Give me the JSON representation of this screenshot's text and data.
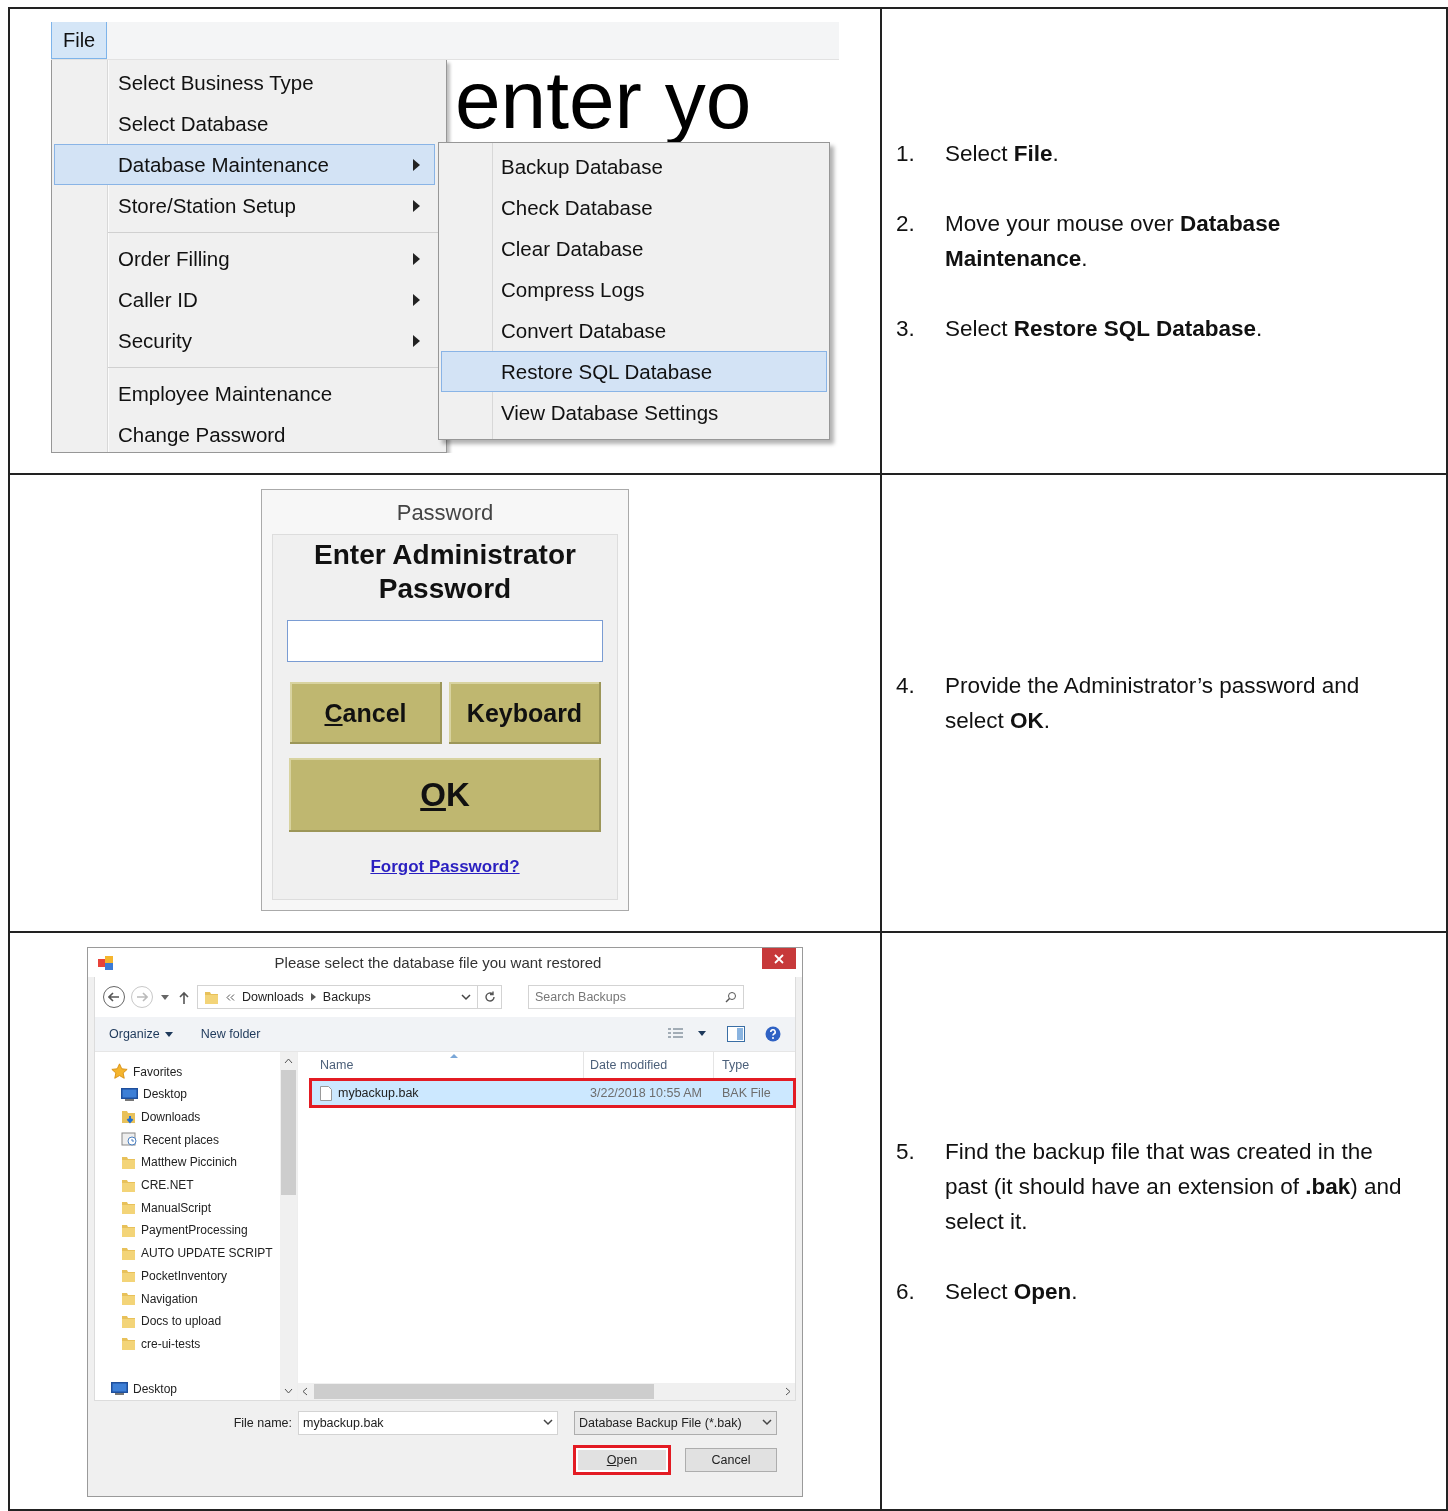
{
  "rows": [
    {
      "kind": "menu",
      "menubar": [
        {
          "label": "File",
          "selected": true
        }
      ],
      "background_text": "enter yo",
      "menu": {
        "groups": [
          [
            {
              "label": "Select Business Type",
              "submenu": false,
              "selected": false
            },
            {
              "label": "Select Database",
              "submenu": false,
              "selected": false
            },
            {
              "label": "Database Maintenance",
              "submenu": true,
              "selected": true
            },
            {
              "label": "Store/Station Setup",
              "submenu": true,
              "selected": false
            }
          ],
          [
            {
              "label": "Order Filling",
              "submenu": true,
              "selected": false
            },
            {
              "label": "Caller ID",
              "submenu": true,
              "selected": false
            },
            {
              "label": "Security",
              "submenu": true,
              "selected": false
            }
          ],
          [
            {
              "label": "Employee Maintenance",
              "submenu": false,
              "selected": false
            },
            {
              "label": "Change Password",
              "submenu": false,
              "selected": false
            }
          ]
        ]
      },
      "submenu": {
        "items": [
          {
            "label": "Backup Database",
            "selected": false
          },
          {
            "label": "Check Database",
            "selected": false
          },
          {
            "label": "Clear Database",
            "selected": false
          },
          {
            "label": "Compress Logs",
            "selected": false
          },
          {
            "label": "Convert Database",
            "selected": false
          },
          {
            "label": "Restore SQL Database",
            "selected": true
          },
          {
            "label": "View Database Settings",
            "selected": false
          }
        ]
      },
      "steps": [
        {
          "number": "1.",
          "text": "Select **File**."
        },
        {
          "number": "2.",
          "text": "Move your mouse over **Database Maintenance**."
        },
        {
          "number": "3.",
          "text": "Select **Restore SQL Database**."
        }
      ]
    },
    {
      "kind": "password",
      "dialog": {
        "title": "Password",
        "heading": "Enter Administrator Password",
        "buttons": [
          {
            "label": "Cancel",
            "underline_first": true
          },
          {
            "label": "Keyboard",
            "underline_first": false
          }
        ],
        "ok": {
          "label": "OK",
          "underline_first": true
        },
        "link": "Forgot Password?"
      },
      "steps": [
        {
          "number": "4.",
          "text": "Provide the Administrator’s password and select **OK**."
        }
      ]
    },
    {
      "kind": "file_dialog",
      "dialog": {
        "title": "Please select the database file you want restored",
        "path": [
          "Downloads",
          "Backups"
        ],
        "search": {
          "placeholder": "Search Backups"
        },
        "toolbar": [
          {
            "label": "Organize",
            "dropdown": true
          },
          {
            "label": "New folder",
            "dropdown": false
          }
        ],
        "nav_pane": [
          {
            "label": "Favorites",
            "kind": "star",
            "children": [
              {
                "label": "Desktop",
                "kind": "desktop"
              },
              {
                "label": "Downloads",
                "kind": "downloads"
              },
              {
                "label": "Recent places",
                "kind": "recent"
              },
              {
                "label": "Matthew Piccinich",
                "kind": "folder"
              },
              {
                "label": "CRE.NET",
                "kind": "folder"
              },
              {
                "label": "ManualScript",
                "kind": "folder"
              },
              {
                "label": "PaymentProcessing",
                "kind": "folder"
              },
              {
                "label": "AUTO UPDATE SCRIPT",
                "kind": "folder"
              },
              {
                "label": "PocketInventory",
                "kind": "folder"
              },
              {
                "label": "Navigation",
                "kind": "folder"
              },
              {
                "label": "Docs to upload",
                "kind": "folder"
              },
              {
                "label": "cre-ui-tests",
                "kind": "folder"
              }
            ]
          },
          {
            "label": "Desktop",
            "kind": "desktop"
          }
        ],
        "columns": [
          "Name",
          "Date modified",
          "Type"
        ],
        "files": [
          {
            "name": "mybackup.bak",
            "date": "3/22/2018 10:55 AM",
            "type": "BAK File",
            "selected": true,
            "highlighted": true
          }
        ],
        "file_name_label": "File name:",
        "file_name": "mybackup.bak",
        "filter": "Database Backup File (*.bak)",
        "buttons": [
          {
            "label": "Open",
            "underline_first": true,
            "highlighted": true
          },
          {
            "label": "Cancel",
            "underline_first": false,
            "highlighted": false
          }
        ]
      },
      "steps": [
        {
          "number": "5.",
          "text": "Find the backup file that was created in the past (it should have an extension of **.bak**) and select it."
        },
        {
          "number": "6.",
          "text": "Select **Open**."
        }
      ]
    }
  ]
}
